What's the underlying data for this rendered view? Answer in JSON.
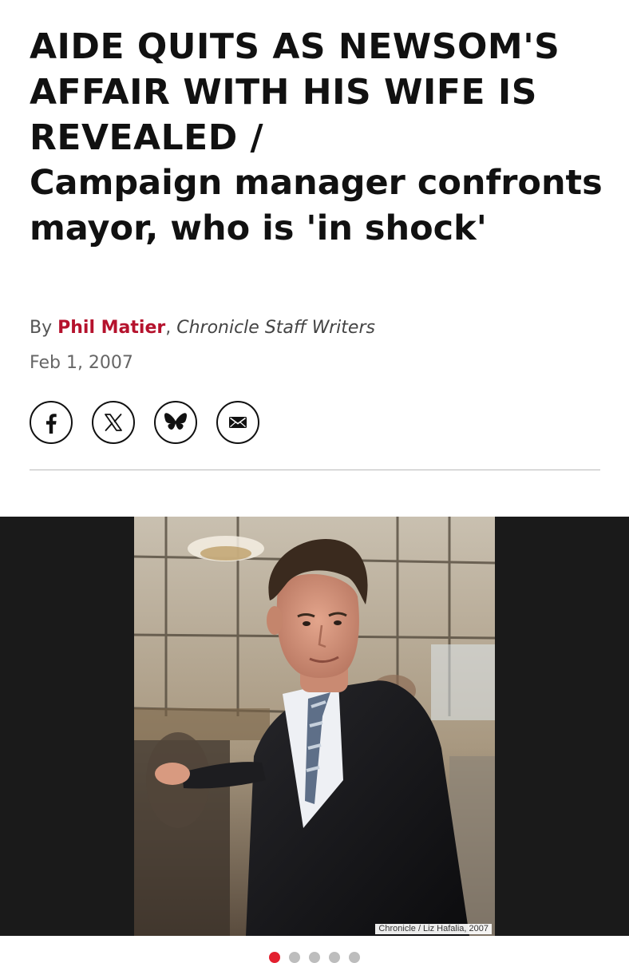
{
  "article": {
    "headline_caps": "AIDE QUITS AS NEWSOM'S AFFAIR WITH HIS WIFE IS REVEALED /",
    "headline_sub": "Campaign manager confronts mayor, who is 'in shock'",
    "byline": {
      "prefix": "By",
      "author": "Phil Matier",
      "separator": ",",
      "affiliation": "Chronicle Staff Writers"
    },
    "date": "Feb 1, 2007",
    "share": [
      {
        "icon": "facebook-icon"
      },
      {
        "icon": "x-icon"
      },
      {
        "icon": "bluesky-icon"
      },
      {
        "icon": "email-icon"
      }
    ]
  },
  "gallery": {
    "photo_credit": "Chronicle / Liz Hafalia, 2007",
    "slide_count": 5,
    "active_slide": 1
  },
  "colors": {
    "author_link": "#b5122d",
    "active_dot": "#e3202f",
    "inactive_dot": "#bdbdbd",
    "gallery_bg": "#1a1a1a"
  }
}
